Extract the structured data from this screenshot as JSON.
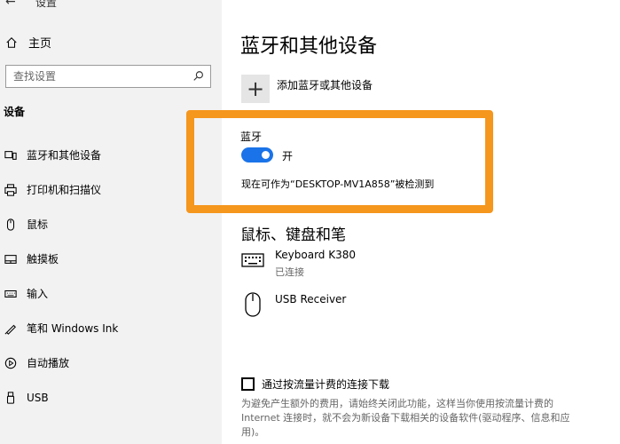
{
  "topbar": {
    "title": "设置"
  },
  "sidebar": {
    "home_label": "主页",
    "search_placeholder": "查找设置",
    "section_title": "设备",
    "items": [
      {
        "label": "蓝牙和其他设备",
        "icon": "bluetooth-devices-icon"
      },
      {
        "label": "打印机和扫描仪",
        "icon": "printer-icon"
      },
      {
        "label": "鼠标",
        "icon": "mouse-icon"
      },
      {
        "label": "触摸板",
        "icon": "touchpad-icon"
      },
      {
        "label": "输入",
        "icon": "keyboard-icon"
      },
      {
        "label": "笔和 Windows Ink",
        "icon": "pen-icon"
      },
      {
        "label": "自动播放",
        "icon": "autoplay-icon"
      },
      {
        "label": "USB",
        "icon": "usb-icon"
      }
    ]
  },
  "main": {
    "title": "蓝牙和其他设备",
    "add_device_label": "添加蓝牙或其他设备",
    "bluetooth": {
      "label": "蓝牙",
      "state": "开",
      "is_on": true,
      "discoverable_text": "现在可作为“DESKTOP-MV1A858”被检测到"
    },
    "section_title": "鼠标、键盘和笔",
    "devices": [
      {
        "name": "Keyboard K380",
        "status": "已连接",
        "icon": "keyboard-icon"
      },
      {
        "name": "USB Receiver",
        "status": "",
        "icon": "mouse-icon"
      }
    ],
    "metered": {
      "label": "通过按流量计费的连接下载",
      "checked": false,
      "description": "为避免产生额外的费用，请始终关闭此功能，这样当你使用按流量计费的 Internet 连接时，就不会为新设备下载相关的设备软件(驱动程序、信息和应用)。"
    }
  },
  "colors": {
    "accent": "#1a73e8",
    "highlight": "#f5961d",
    "sidebar_bg": "#f2f2f2"
  }
}
